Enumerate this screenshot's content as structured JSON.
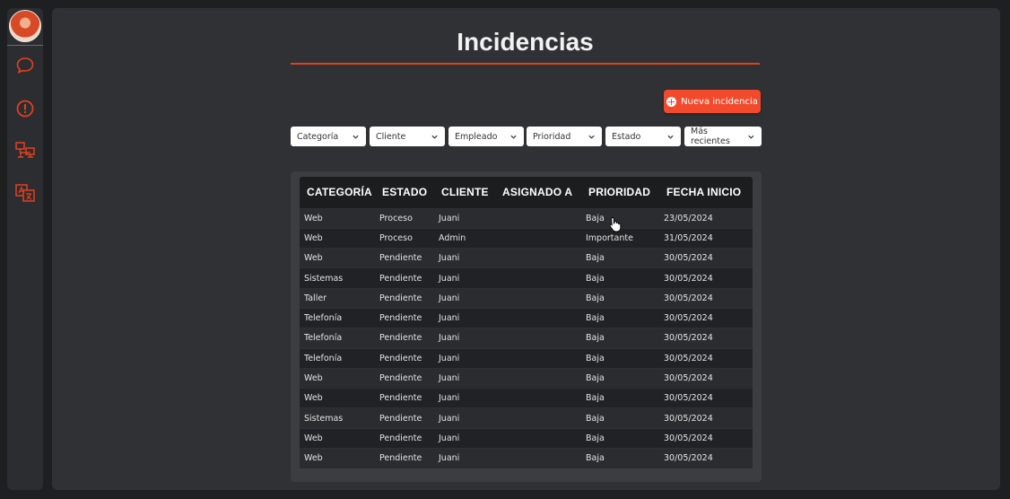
{
  "page": {
    "title": "Incidencias"
  },
  "sidebar": {
    "items": [
      {
        "icon": "chat-bubble-icon"
      },
      {
        "icon": "alert-circle-icon"
      },
      {
        "icon": "network-computer-icon"
      },
      {
        "icon": "translate-icon"
      }
    ],
    "accent": "#e3401f"
  },
  "toolbar": {
    "new_label": "Nueva incidencia"
  },
  "filters": [
    {
      "label": "Categoría"
    },
    {
      "label": "Cliente"
    },
    {
      "label": "Empleado"
    },
    {
      "label": "Prioridad"
    },
    {
      "label": "Estado"
    },
    {
      "label": "Más recientes"
    }
  ],
  "table": {
    "headers": [
      "CATEGORÍA",
      "ESTADO",
      "CLIENTE",
      "ASIGNADO A",
      "PRIORIDAD",
      "FECHA INICIO"
    ],
    "rows": [
      [
        "Web",
        "Proceso",
        "Juani",
        "",
        "Baja",
        "23/05/2024"
      ],
      [
        "Web",
        "Proceso",
        "Admin",
        "",
        "Importante",
        "31/05/2024"
      ],
      [
        "Web",
        "Pendiente",
        "Juani",
        "",
        "Baja",
        "30/05/2024"
      ],
      [
        "Sistemas",
        "Pendiente",
        "Juani",
        "",
        "Baja",
        "30/05/2024"
      ],
      [
        "Taller",
        "Pendiente",
        "Juani",
        "",
        "Baja",
        "30/05/2024"
      ],
      [
        "Telefonía",
        "Pendiente",
        "Juani",
        "",
        "Baja",
        "30/05/2024"
      ],
      [
        "Telefonía",
        "Pendiente",
        "Juani",
        "",
        "Baja",
        "30/05/2024"
      ],
      [
        "Telefonía",
        "Pendiente",
        "Juani",
        "",
        "Baja",
        "30/05/2024"
      ],
      [
        "Web",
        "Pendiente",
        "Juani",
        "",
        "Baja",
        "30/05/2024"
      ],
      [
        "Web",
        "Pendiente",
        "Juani",
        "",
        "Baja",
        "30/05/2024"
      ],
      [
        "Sistemas",
        "Pendiente",
        "Juani",
        "",
        "Baja",
        "30/05/2024"
      ],
      [
        "Web",
        "Pendiente",
        "Juani",
        "",
        "Baja",
        "30/05/2024"
      ],
      [
        "Web",
        "Pendiente",
        "Juani",
        "",
        "Baja",
        "30/05/2024"
      ]
    ]
  }
}
